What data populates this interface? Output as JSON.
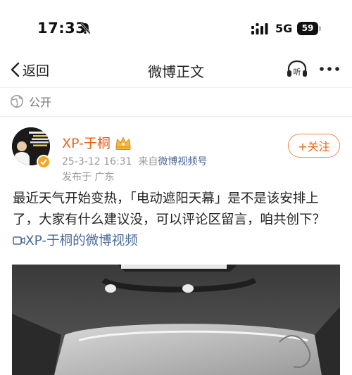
{
  "status_bar": {
    "time": "17:33",
    "network": "5G",
    "battery": "59"
  },
  "nav": {
    "back_label": "返回",
    "title": "微博正文",
    "listen_label": "听"
  },
  "visibility": {
    "label": "公开"
  },
  "post": {
    "username": "XP-于桐",
    "meta_date": "25-3-12 16:31",
    "meta_prefix": "来自",
    "meta_source": "微博视频号",
    "location": "发布于 广东",
    "follow_label": "+关注",
    "text": "最近天气开始变热，「电动遮阳天幕」是不是该安排上了，大家有什么建议没，可以评论区留言，咱共创下？",
    "video_link": "XP-于桐的微博视频"
  },
  "colors": {
    "accent": "#e8641b",
    "link": "#4a6b99"
  }
}
